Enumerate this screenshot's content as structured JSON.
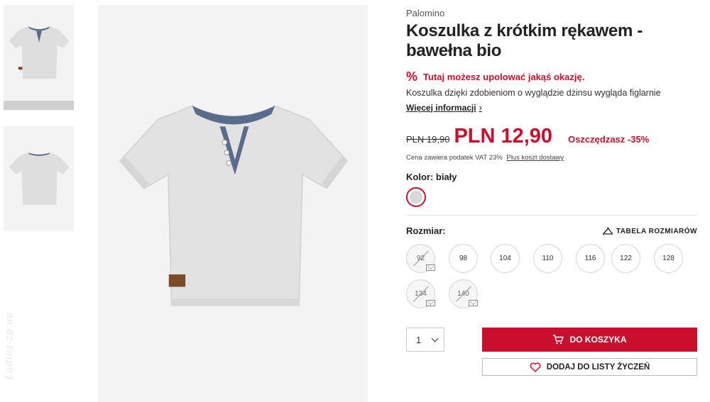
{
  "watermark": "Ladies-zp.ua",
  "product": {
    "brand": "Palomino",
    "title": "Koszulka z krótkim rękawem - bawełna bio",
    "deal_icon": "%",
    "deal_text": "Tutaj możesz upolować jakąś okazję.",
    "description": "Koszulka dzięki zdobieniom o wyglądzie dżinsu wygląda figlarnie",
    "more_info": "Więcej informacji",
    "old_price": "PLN 19,90",
    "price": "PLN 12,90",
    "savings": "Oszczędzasz -35%",
    "vat_note": "Cena zawiera podatek VAT 23%",
    "shipping_link": "Plus koszt dostawy",
    "color_label": "Kolor: biały",
    "size_label": "Rozmiar:",
    "size_table": "TABELA ROZMIARÓW",
    "sizes": [
      {
        "label": "92",
        "available": false
      },
      {
        "label": "98",
        "available": true
      },
      {
        "label": "104",
        "available": true
      },
      {
        "label": "110",
        "available": true
      },
      {
        "label": "116",
        "available": true
      },
      {
        "label": "122",
        "available": true
      },
      {
        "label": "128",
        "available": true
      },
      {
        "label": "134",
        "available": false
      },
      {
        "label": "140",
        "available": false
      }
    ],
    "quantity": "1",
    "add_to_cart": "DO KOSZYKA",
    "add_to_wishlist": "DODAJ DO LISTY ŻYCZEŃ"
  },
  "colors": {
    "accent": "#c8102e",
    "swatch": "#d8d8d8",
    "shirt": "#e2e2e2",
    "denim": "#5b6b8c"
  },
  "icons": [
    "percent-icon",
    "chevron-right-icon",
    "hanger-icon",
    "mail-icon",
    "chevron-down-icon",
    "cart-icon",
    "heart-icon"
  ]
}
